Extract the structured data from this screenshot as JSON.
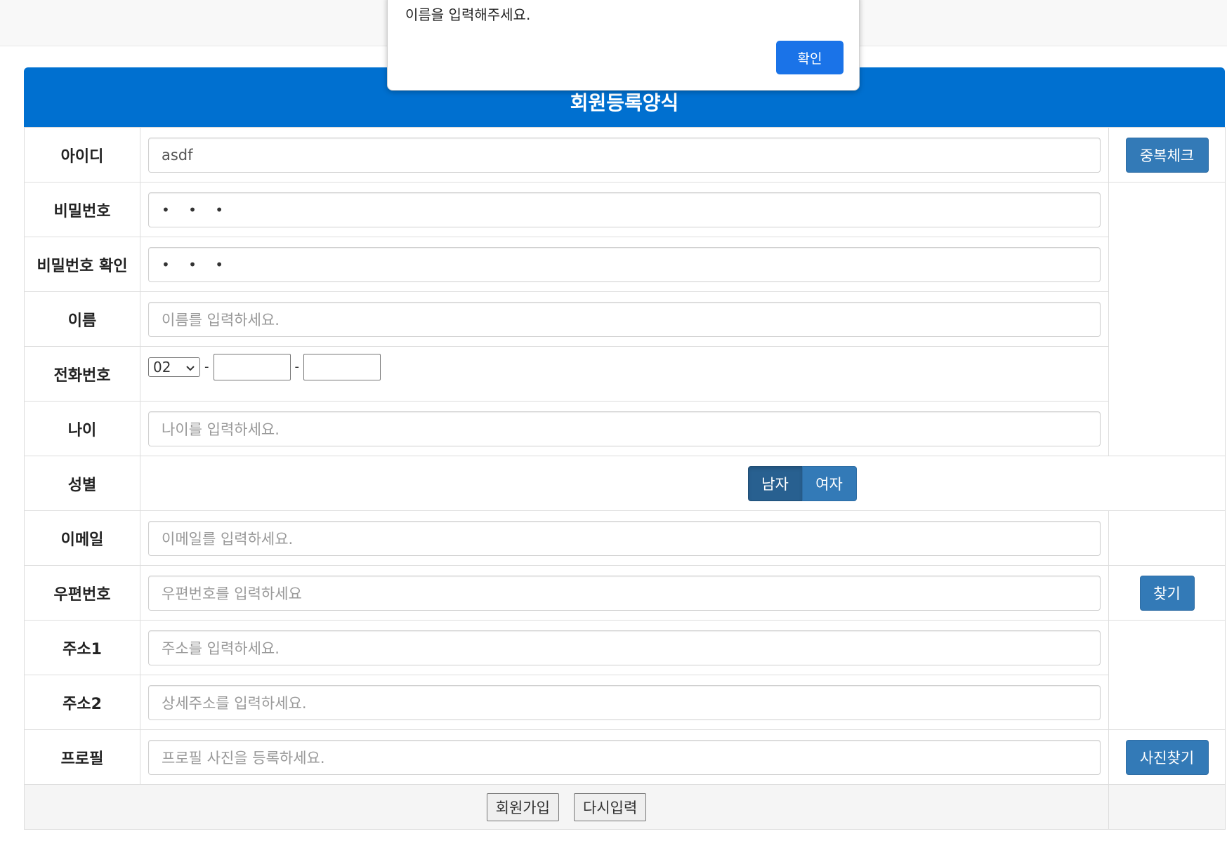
{
  "form": {
    "title": "회원등록양식",
    "fields": {
      "id": {
        "label": "아이디",
        "value": "asdf"
      },
      "password": {
        "label": "비밀번호",
        "value": "• • •"
      },
      "password_confirm": {
        "label": "비밀번호 확인",
        "value": "• • •"
      },
      "name": {
        "label": "이름",
        "placeholder": "이름를 입력하세요."
      },
      "phone": {
        "label": "전화번호",
        "prefix": "02",
        "separator": "-"
      },
      "age": {
        "label": "나이",
        "placeholder": "나이를 입력하세요."
      },
      "gender": {
        "label": "성별",
        "options": [
          "남자",
          "여자"
        ],
        "selected": "남자"
      },
      "email": {
        "label": "이메일",
        "placeholder": "이메일를 입력하세요."
      },
      "zipcode": {
        "label": "우편번호",
        "placeholder": "우편번호를 입력하세요"
      },
      "address1": {
        "label": "주소1",
        "placeholder": "주소를 입력하세요."
      },
      "address2": {
        "label": "주소2",
        "placeholder": "상세주소를 입력하세요."
      },
      "profile": {
        "label": "프로필",
        "placeholder": "프로필 사진을 등록하세요."
      }
    },
    "buttons": {
      "dup_check": "중복체크",
      "find": "찾기",
      "photo_find": "사진찾기",
      "submit": "회원가입",
      "reset": "다시입력"
    }
  },
  "alert": {
    "message": "이름을 입력해주세요.",
    "ok": "확인"
  },
  "colors": {
    "header_blue": "#0070d0",
    "button_blue": "#337ab7",
    "dialog_button": "#1a73e8"
  }
}
